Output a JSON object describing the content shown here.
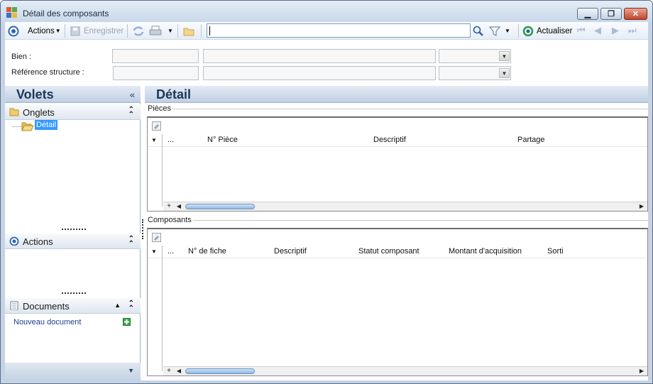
{
  "window": {
    "title": "Détail des composants"
  },
  "toolbar": {
    "actions_label": "Actions",
    "save_label": "Enregistrer",
    "search_value": "",
    "refresh_label": "Actualiser"
  },
  "filters": {
    "bien_label": "Bien :",
    "reference_label": "Référence structure :"
  },
  "side": {
    "title": "Volets",
    "onglets_label": "Onglets",
    "tree_item": "Détail",
    "actions_label": "Actions",
    "documents_label": "Documents",
    "new_document_label": "Nouveau document"
  },
  "main": {
    "title": "Détail",
    "pieces": {
      "group_label": "Pièces",
      "columns": [
        "...",
        "N° Pièce",
        "Descriptif",
        "Partage"
      ]
    },
    "composants": {
      "group_label": "Composants",
      "columns": [
        "...",
        "N° de fiche",
        "Descriptif",
        "Statut composant",
        "Montant d'acquisition",
        "Sorti"
      ]
    }
  },
  "colors": {
    "accent": "#1d3557",
    "frame": "#c5d3e4"
  },
  "icons": [
    "app-icon",
    "actions-icon",
    "save-icon",
    "refresh-icon",
    "print-icon",
    "folder-icon",
    "search-icon",
    "filter-icon",
    "refresh-green-icon",
    "first-icon",
    "prev-icon",
    "next-icon",
    "last-icon"
  ]
}
